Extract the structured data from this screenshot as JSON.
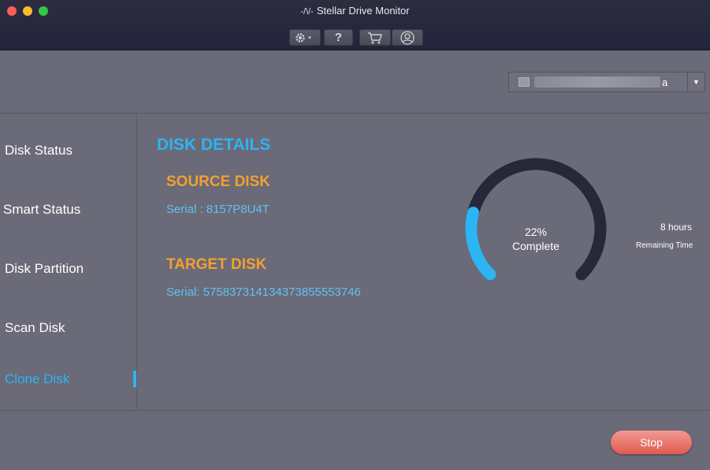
{
  "window": {
    "title": "Stellar Drive Monitor",
    "title_icon": "pulse-icon",
    "help_label": "?"
  },
  "drive_selector": {
    "visible_suffix": "a"
  },
  "sidebar": {
    "items": [
      {
        "label": "Disk Status"
      },
      {
        "label": "Smart Status"
      },
      {
        "label": "Disk Partition"
      },
      {
        "label": "Scan Disk"
      },
      {
        "label": "Clone Disk",
        "active": true
      }
    ]
  },
  "details": {
    "heading": "DISK DETAILS",
    "source_heading": "SOURCE DISK",
    "source_serial": "Serial : 8157P8U4T",
    "target_heading": "TARGET DISK",
    "target_serial": "Serial: 575837314134373855553746"
  },
  "progress": {
    "percent_text": "22%",
    "complete_label": "Complete",
    "fraction": 0.22,
    "remaining_value": "8 hours",
    "remaining_label": "Remaining Time"
  },
  "actions": {
    "stop_label": "Stop"
  },
  "colors": {
    "accent_blue": "#2db4f3",
    "accent_orange": "#f4a02f",
    "gauge_track": "#27273a",
    "stop_button": "#e8665c"
  }
}
